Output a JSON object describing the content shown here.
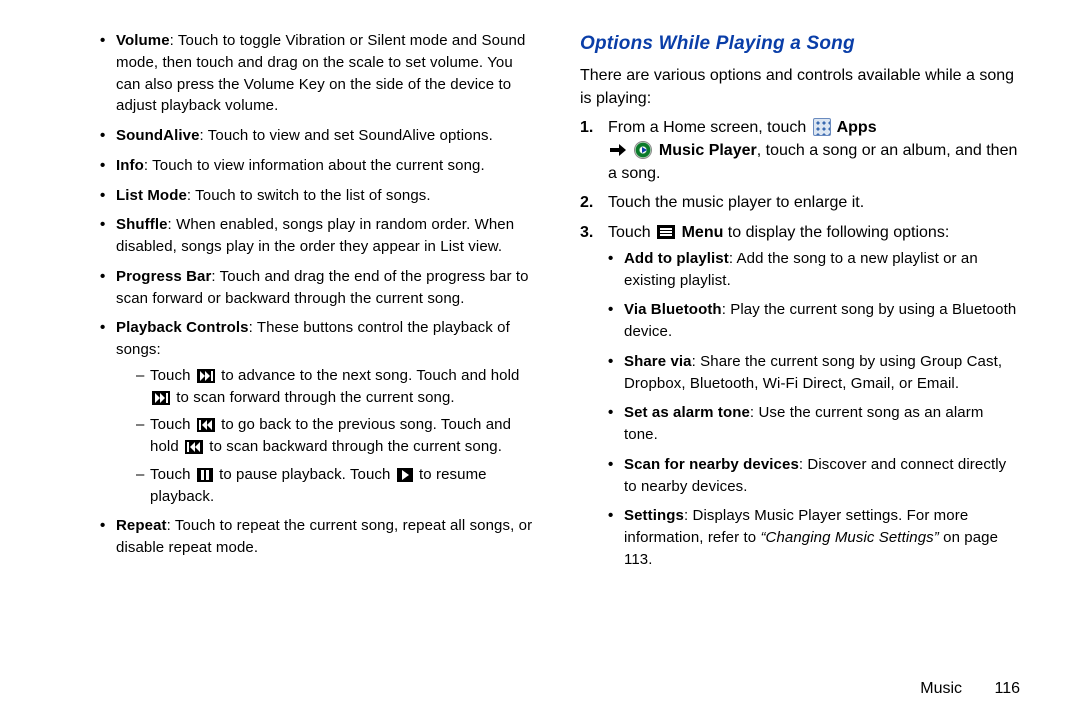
{
  "left": {
    "volume_label": "Volume",
    "volume_text": ": Touch to toggle Vibration or Silent mode and Sound mode, then touch and drag on the scale to set volume. You can also press the Volume Key on the side of the device to adjust playback volume.",
    "soundalive_label": "SoundAlive",
    "soundalive_text": ": Touch to view and set SoundAlive options.",
    "info_label": "Info",
    "info_text": ": Touch to view information about the current song.",
    "listmode_label": "List Mode",
    "listmode_text": ": Touch to switch to the list of songs.",
    "shuffle_label": "Shuffle",
    "shuffle_text": ": When enabled, songs play in random order. When disabled, songs play in the order they appear in List view.",
    "progress_label": "Progress Bar",
    "progress_text": ": Touch and drag the end of the progress bar to scan forward or backward through the current song.",
    "playback_label": "Playback Controls",
    "playback_text": ": These buttons control the playback of songs:",
    "pb_next_a": "Touch ",
    "pb_next_b": " to advance to the next song. Touch and hold ",
    "pb_next_c": " to scan forward through the current song.",
    "pb_prev_a": "Touch ",
    "pb_prev_b": " to go back to the previous song. Touch and hold ",
    "pb_prev_c": " to scan backward through the current song.",
    "pb_pause_a": "Touch ",
    "pb_pause_b": " to pause playback. Touch ",
    "pb_pause_c": " to resume playback.",
    "repeat_label": "Repeat",
    "repeat_text": ": Touch to repeat the current song, repeat all songs, or disable repeat mode."
  },
  "right": {
    "heading": "Options While Playing a Song",
    "intro": "There are various options and controls available while a song is playing:",
    "s1_num": "1.",
    "s1_a": "From a Home screen, touch ",
    "s1_apps": " Apps",
    "s1_b": " Music Player",
    "s1_c": ", touch a song or an album, and then a song.",
    "s2_num": "2.",
    "s2": "Touch the music player to enlarge it.",
    "s3_num": "3.",
    "s3_a": "Touch ",
    "s3_menu": " Menu",
    "s3_b": " to display the following options:",
    "o1_label": "Add to playlist",
    "o1_text": ": Add the song to a new playlist or an existing playlist.",
    "o2_label": "Via Bluetooth",
    "o2_text": ": Play the current song by using a Bluetooth device.",
    "o3_label": "Share via",
    "o3_text": ": Share the current song by using Group Cast, Dropbox, Bluetooth, Wi-Fi Direct, Gmail, or Email.",
    "o4_label": "Set as alarm tone",
    "o4_text": ": Use the current song as an alarm tone.",
    "o5_label": "Scan for nearby devices",
    "o5_text": ": Discover and connect directly to nearby devices.",
    "o6_label": "Settings",
    "o6_text_a": ": Displays Music Player settings. For more information, refer to ",
    "o6_ref": "“Changing Music Settings”",
    "o6_text_b": " on page 113."
  },
  "footer": {
    "section": "Music",
    "page": "116"
  }
}
